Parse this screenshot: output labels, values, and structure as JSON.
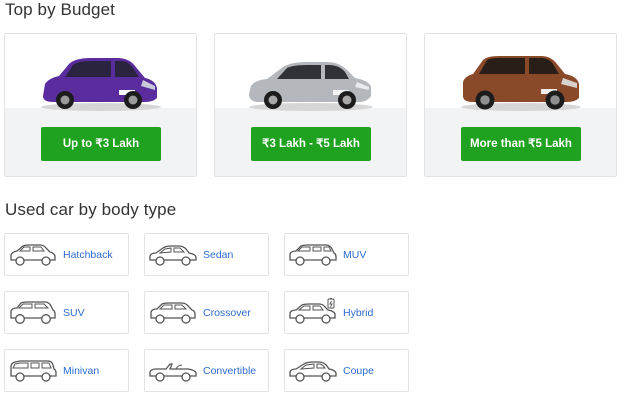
{
  "budget_section": {
    "title": "Top by Budget",
    "cards": [
      {
        "label": "Up to ₹3 Lakh",
        "car_color": "#5a2c9e",
        "icon": "purple-hatchback-car"
      },
      {
        "label": "₹3 Lakh - ₹5 Lakh",
        "car_color": "#b4b8bc",
        "icon": "silver-sedan-car"
      },
      {
        "label": "More than ₹5 Lakh",
        "car_color": "#8a4a2a",
        "icon": "brown-suv-car"
      }
    ]
  },
  "body_section": {
    "title": "Used car by body type",
    "types": [
      {
        "label": "Hatchback",
        "icon": "hatchback-icon"
      },
      {
        "label": "Sedan",
        "icon": "sedan-icon"
      },
      {
        "label": "MUV",
        "icon": "muv-icon"
      },
      {
        "label": "SUV",
        "icon": "suv-icon"
      },
      {
        "label": "Crossover",
        "icon": "crossover-icon"
      },
      {
        "label": "Hybrid",
        "icon": "hybrid-icon"
      },
      {
        "label": "Minivan",
        "icon": "minivan-icon"
      },
      {
        "label": "Convertible",
        "icon": "convertible-icon"
      },
      {
        "label": "Coupe",
        "icon": "coupe-icon"
      }
    ]
  },
  "colors": {
    "button_green": "#1fa21f",
    "link_blue": "#2d6bd0",
    "card_border": "#e3e3e3",
    "card_shade": "#f1f3f5"
  }
}
